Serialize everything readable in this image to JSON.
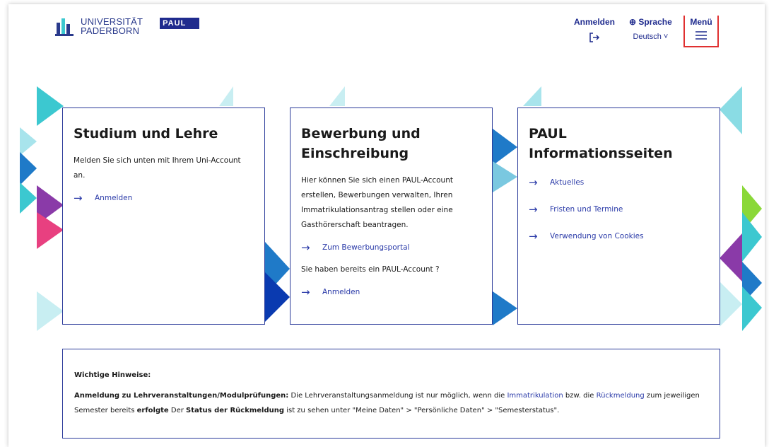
{
  "header": {
    "university_line1": "UNIVERSITÄT",
    "university_line2": "PADERBORN",
    "paul_logo": "PAUL",
    "login_label": "Anmelden",
    "language_label": "Sprache",
    "language_value": "Deutsch",
    "menu_label": "Menü"
  },
  "cards": [
    {
      "title": "Studium und Lehre",
      "text": "Melden Sie sich unten mit Ihrem Uni-Account an.",
      "link": "Anmelden"
    },
    {
      "title": "Bewerbung und Einschreibung",
      "text": "Hier können Sie sich einen PAUL-Account erstellen, Bewerbungen verwalten, Ihren Immatrikulationsantrag stellen oder eine Gasthörerschaft beantragen.",
      "link1": "Zum Bewerbungsportal",
      "text2": "Sie haben bereits ein PAUL-Account ?",
      "link2": "Anmelden"
    },
    {
      "title": "PAUL Informationsseiten",
      "links": [
        "Aktuelles",
        "Fristen und Termine",
        "Verwendung von Cookies"
      ]
    }
  ],
  "notice": {
    "heading": "Wichtige Hinweise:",
    "lead": "Anmeldung zu Lehrveranstaltungen/Modulprüfungen:",
    "t1": " Die Lehrveranstaltungsanmeldung ist nur möglich, wenn die ",
    "link1": "Immatrikulation",
    "t2": " bzw. die ",
    "link2": "Rückmeldung",
    "t3": " zum jeweiligen Semester bereits ",
    "bold1": "erfolgte",
    "t4": " Der ",
    "bold2": "Status der Rückmeldung",
    "t5": " ist zu sehen unter \"Meine Daten\" > \"Persönliche Daten\" > \"Semesterstatus\"."
  },
  "colors": {
    "brand_blue": "#1f2b8e",
    "link_blue": "#2a3aa8",
    "menu_highlight": "#e03030"
  }
}
